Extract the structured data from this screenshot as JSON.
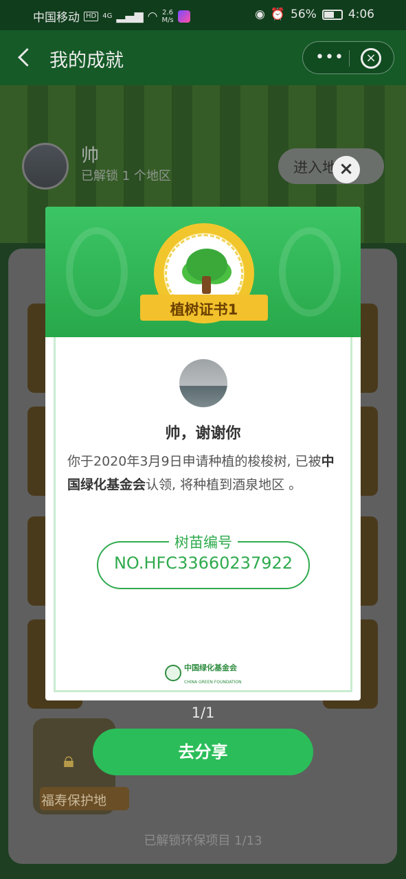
{
  "status_bar": {
    "carrier": "中国移动",
    "hd": "HD",
    "network": "4G",
    "speed_value": "2.6",
    "speed_unit": "M/s",
    "battery_percent": "56%",
    "time": "4:06"
  },
  "header": {
    "title": "我的成就",
    "more_label": "•••"
  },
  "profile": {
    "name": "帅",
    "subtitle": "已解锁 1 个地区",
    "enter_label": "进入地"
  },
  "background": {
    "locked_badge_label": "福寿保护地",
    "footer_text": "已解锁环保项目 1/13"
  },
  "certificate": {
    "ribbon_title": "植树证书1",
    "greeting": "帅，谢谢你",
    "body_prefix": "你于2020年3月9日申请种植的梭梭树, 已被",
    "body_org": "中国绿化基金会",
    "body_suffix": "认领, 将种植到酒泉地区 。",
    "number_label": "树苗编号",
    "number_value": "NO.HFC33660237922",
    "org_logo_name": "中国绿化基金会",
    "org_logo_en": "CHINA GREEN FOUNDATION"
  },
  "pager": "1/1",
  "share_button": "去分享",
  "colors": {
    "accent_green": "#2bbd5a",
    "ribbon_gold": "#f2c12c",
    "number_green": "#2faa4d"
  }
}
